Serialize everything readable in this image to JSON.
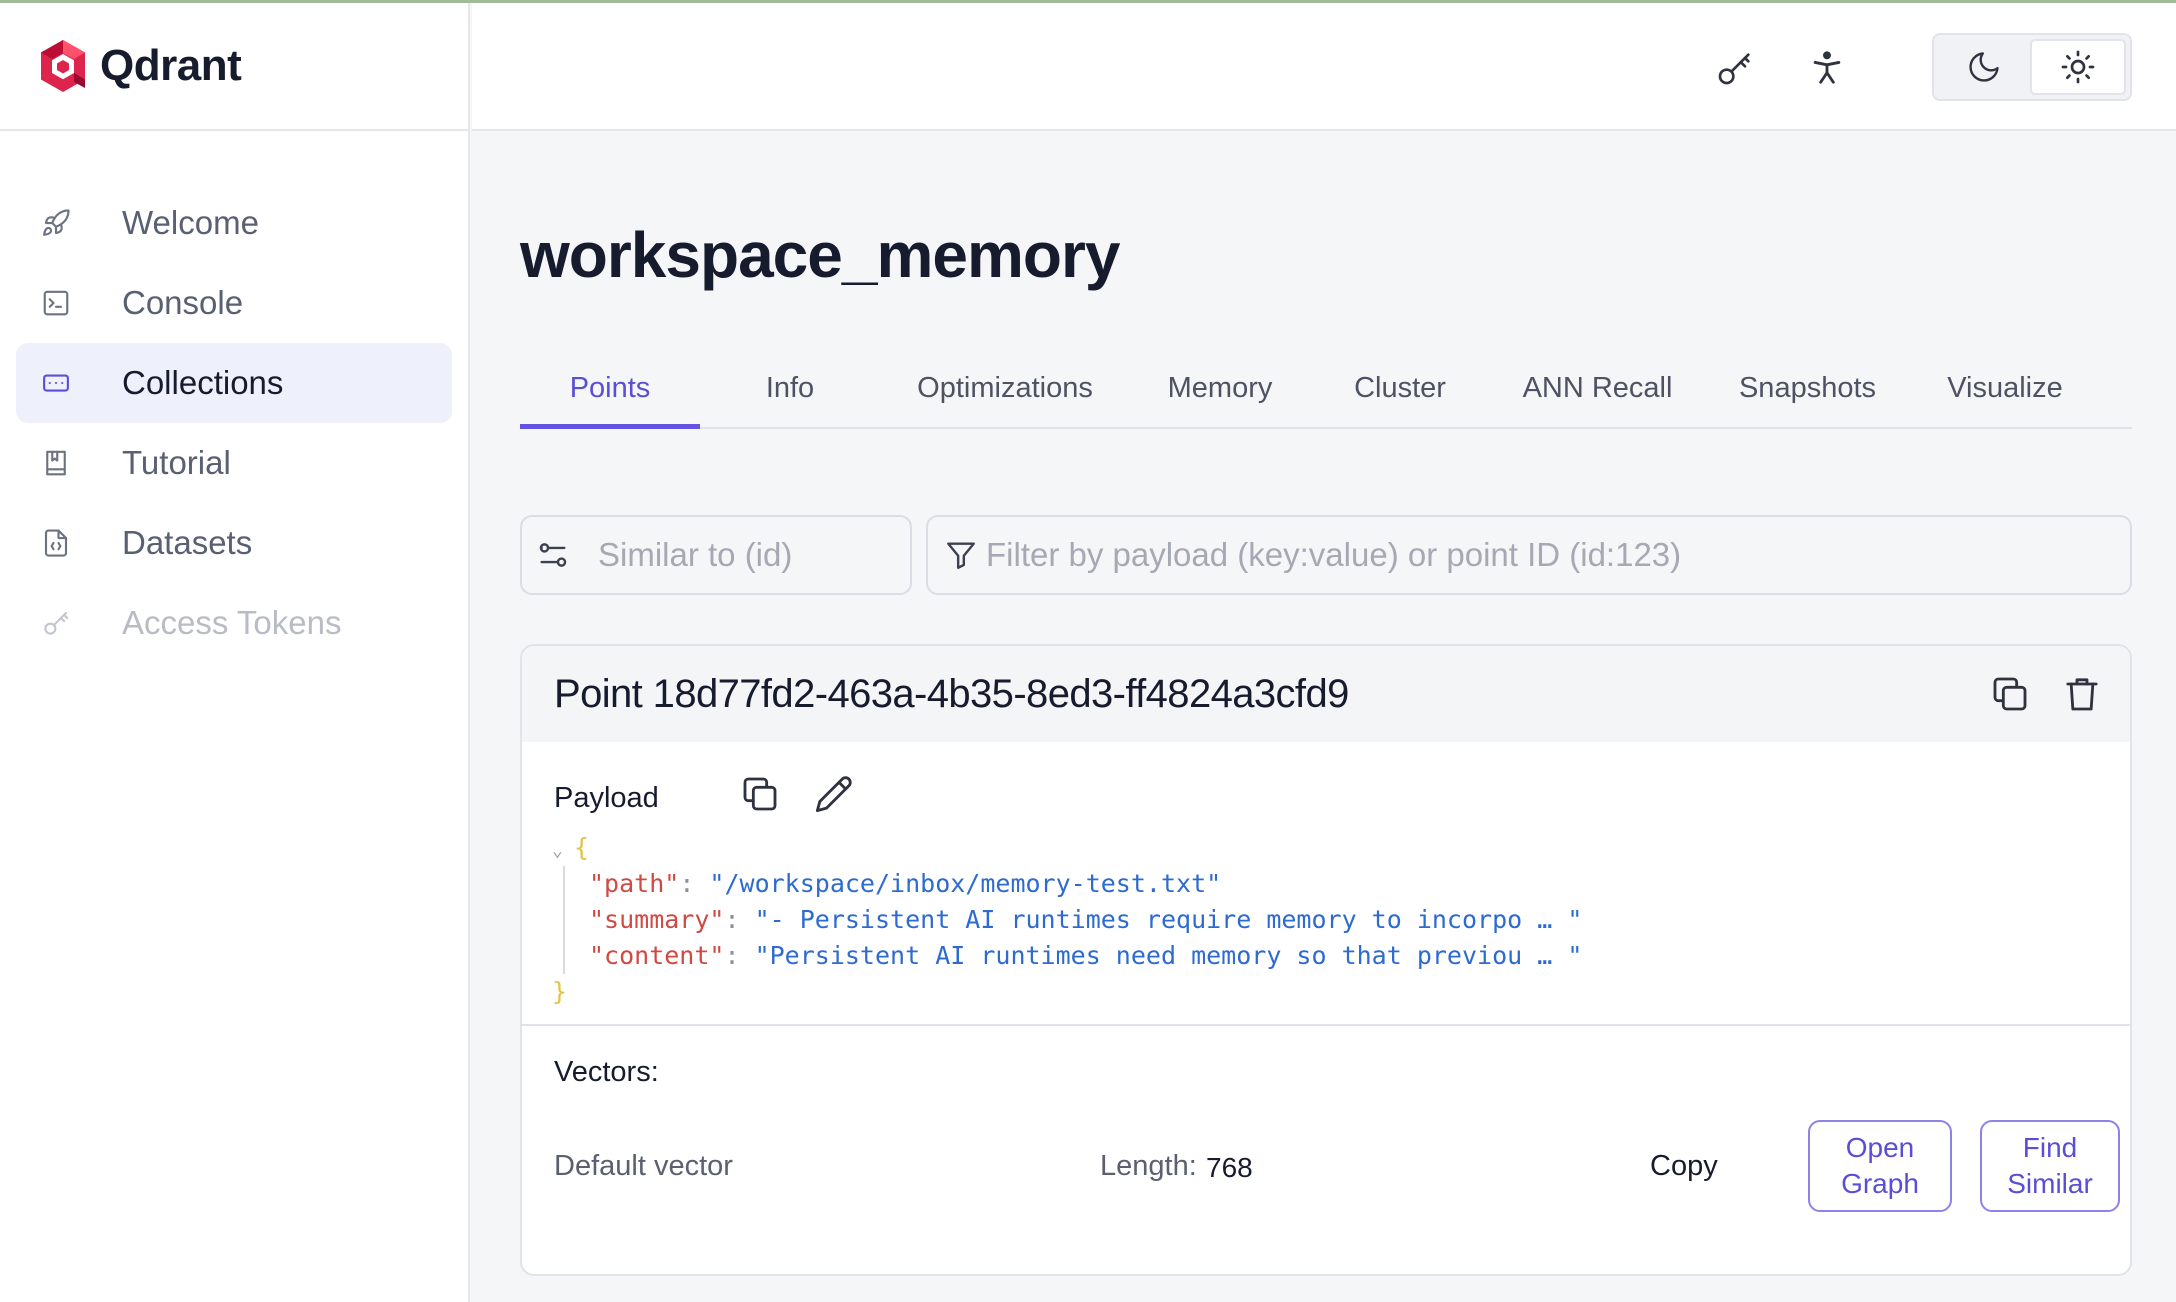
{
  "app": {
    "name": "Qdrant"
  },
  "sidebar": {
    "items": [
      {
        "label": "Welcome",
        "icon": "rocket-icon",
        "active": false,
        "disabled": false
      },
      {
        "label": "Console",
        "icon": "terminal-icon",
        "active": false,
        "disabled": false
      },
      {
        "label": "Collections",
        "icon": "collection-icon",
        "active": true,
        "disabled": false
      },
      {
        "label": "Tutorial",
        "icon": "book-icon",
        "active": false,
        "disabled": false
      },
      {
        "label": "Datasets",
        "icon": "file-code-icon",
        "active": false,
        "disabled": false
      },
      {
        "label": "Access Tokens",
        "icon": "key-icon",
        "active": false,
        "disabled": true
      }
    ]
  },
  "header": {
    "icons": [
      "key-icon",
      "accessibility-icon"
    ],
    "theme": {
      "options": [
        "moon-icon",
        "sun-icon"
      ],
      "selected": "sun-icon"
    }
  },
  "collection": {
    "title": "workspace_memory",
    "tabs": [
      "Points",
      "Info",
      "Optimizations",
      "Memory",
      "Cluster",
      "ANN Recall",
      "Snapshots",
      "Visualize"
    ],
    "active_tab": "Points"
  },
  "search": {
    "similar_placeholder": "Similar to (id)",
    "filter_placeholder": "Filter by payload (key:value) or point ID (id:123)"
  },
  "point": {
    "title": "Point 18d77fd2-463a-4b35-8ed3-ff4824a3cfd9",
    "payload_label": "Payload",
    "payload": {
      "open_brace": "{",
      "close_brace": "}",
      "entries": [
        {
          "key": "\"path\"",
          "value": "\"/workspace/inbox/memory-test.txt\""
        },
        {
          "key": "\"summary\"",
          "value": "\"- Persistent AI runtimes require memory to incorpo … \""
        },
        {
          "key": "\"content\"",
          "value": "\"Persistent AI runtimes need memory so that previou … \""
        }
      ]
    },
    "vectors_label": "Vectors:",
    "vector": {
      "name": "Default vector",
      "length_label": "Length:",
      "length": "768",
      "copy_label": "Copy",
      "open_graph_label": "Open Graph",
      "find_similar_label": "Find Similar"
    }
  },
  "colors": {
    "accent": "#5b4ed6",
    "active_nav_bg": "#eef0fb",
    "json_key": "#d04a44",
    "json_string": "#2e6bd0",
    "json_brace": "#e3c34a"
  }
}
